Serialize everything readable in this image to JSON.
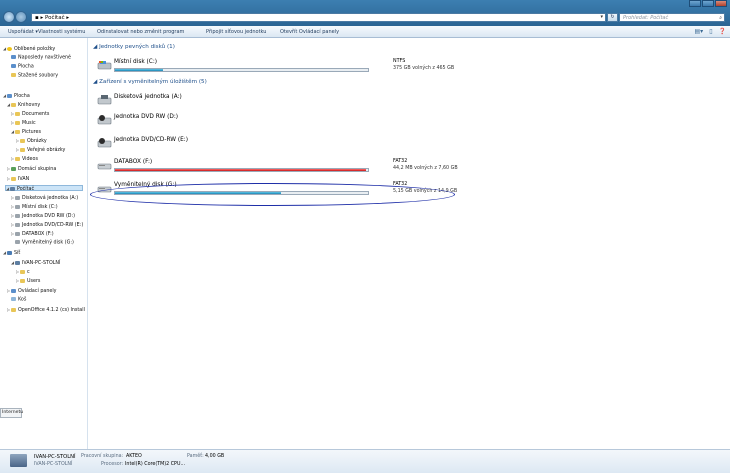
{
  "address": {
    "crumb": "Počítač",
    "search_placeholder": "Prohledat: Počítač"
  },
  "toolbar": {
    "items": [
      "Uspořádat",
      "Vlastnosti systému",
      "Odinstalovat nebo změnit program",
      "Připojit síťovou jednotku",
      "Otevřít Ovládací panely"
    ]
  },
  "nav": {
    "favorites": "Oblíbené položky",
    "recent": "Naposledy navštívené",
    "desktop_fav": "Plocha",
    "downloads": "Stažené soubory",
    "desktop": "Plocha",
    "libraries": "Knihovny",
    "documents": "Documents",
    "music": "Music",
    "pictures": "Pictures",
    "obrazky": "Obrázky",
    "verejne": "Veřejné obrázky",
    "videos": "Videos",
    "homegroup": "Domácí skupina",
    "user": "IVAN",
    "computer": "Počítač",
    "floppy": "Disketová jednotka (A:)",
    "local": "Místní disk (C:)",
    "dvd_d": "Jednotka DVD RW (D:)",
    "dvd_e": "Jednotka DVD/CD-RW (E:)",
    "databox": "DATABOX (F:)",
    "removable": "Vyměnitelný disk (G:)",
    "network": "Síť",
    "pc": "IVAN-PC-STOLNÍ",
    "c": "c",
    "users": "Users",
    "control_panel": "Ovládací panely",
    "recycle": "Koš",
    "openoffice": "OpenOffice 4.1.2 (cs) Install"
  },
  "groups": {
    "fixed": "Jednotky pevných disků (1)",
    "removable": "Zařízení s vyměnitelným úložištěm (5)"
  },
  "drives": {
    "c": {
      "name": "Místní disk (C:)",
      "fs": "NTFS",
      "free": "375 GB volných z 465 GB",
      "used_fraction": 0.19
    },
    "a": {
      "name": "Disketová jednotka (A:)"
    },
    "d": {
      "name": "Jednotka DVD RW (D:)"
    },
    "e": {
      "name": "Jednotka DVD/CD-RW (E:)"
    },
    "f": {
      "name": "DATABOX (F:)",
      "fs": "FAT32",
      "free": "44,2 MB volných z 7,60 GB",
      "used_fraction": 0.994
    },
    "g": {
      "name": "Vyměnitelný disk (G:)",
      "fs": "FAT32",
      "free": "5,15 GB volných z 14,9 GB",
      "used_fraction": 0.655
    }
  },
  "status": {
    "pcname": "IVAN-PC-STOLNÍ",
    "pcname2": "IVAN-PC-STOLNÍ",
    "workgroup_label": "Pracovní skupina:",
    "workgroup": "AKTEO",
    "memory_label": "Paměť:",
    "memory": "4,00 GB",
    "processor_label": "Procesor:",
    "processor": "Intel(R) Core(TM)2 CPU..."
  },
  "tooltip": "Internetu",
  "colors": {
    "accent": "#1d86b6",
    "warning": "#c81616",
    "annotation": "#1f2fa8"
  }
}
